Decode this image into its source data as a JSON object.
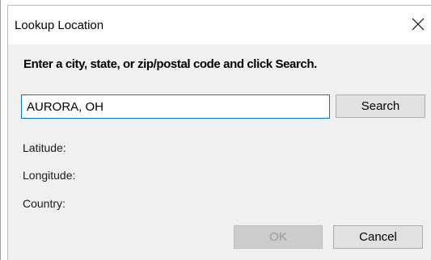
{
  "window": {
    "title": "Lookup Location"
  },
  "prompt": {
    "instruction": "Enter a city, state, or zip/postal code and click Search."
  },
  "search": {
    "value": "AURORA, OH",
    "button_label": "Search"
  },
  "results": {
    "latitude_label": "Latitude:",
    "longitude_label": "Longitude:",
    "country_label": "Country:"
  },
  "footer": {
    "ok_label": "OK",
    "cancel_label": "Cancel"
  },
  "icons": {
    "close": "close-icon"
  },
  "colors": {
    "focus_border": "#0078d7",
    "dialog_bg": "#f0f0f0",
    "disabled_text": "#9a9a9a"
  }
}
